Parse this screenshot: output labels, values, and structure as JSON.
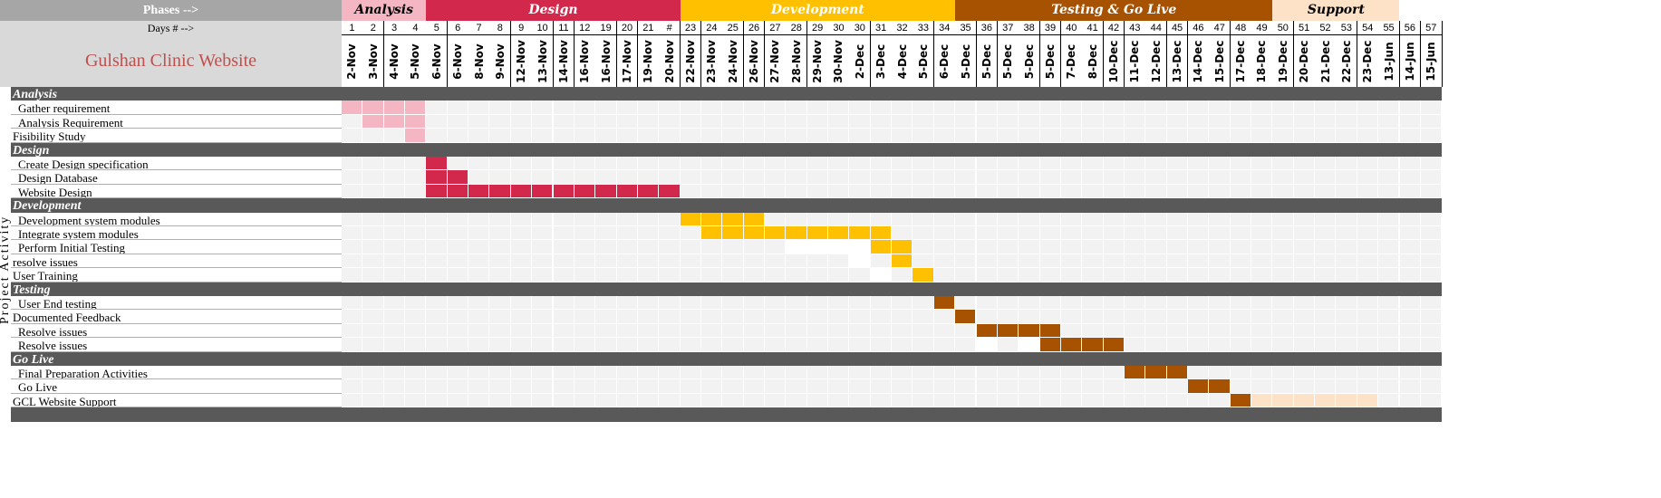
{
  "header": {
    "phases_label": "Phases -->",
    "days_label": "Days # -->",
    "project_title": "Gulshan Clinic Website",
    "side_label": "Project Activity"
  },
  "phase_headers": [
    {
      "label": "Analysis",
      "start": 0,
      "end": 3,
      "bg": "#f4b6c2",
      "color": "#000000"
    },
    {
      "label": "Design",
      "start": 4,
      "end": 15,
      "bg": "#d1284b",
      "color": "#ffffff"
    },
    {
      "label": "Development",
      "start": 16,
      "end": 28,
      "bg": "#ffc000",
      "color": "#ffffff"
    },
    {
      "label": "Testing & Go Live",
      "start": 29,
      "end": 43,
      "bg": "#a65200",
      "color": "#ffffff"
    },
    {
      "label": "Support",
      "start": 44,
      "end": 49,
      "bg": "#fde2c8",
      "color": "#000000"
    }
  ],
  "days": [
    "1",
    "2",
    "3",
    "4",
    "5",
    "6",
    "7",
    "8",
    "9",
    "10",
    "11",
    "12",
    "19",
    "20",
    "21",
    "#",
    "23",
    "24",
    "25",
    "26",
    "27",
    "28",
    "29",
    "30",
    "30",
    "31",
    "32",
    "33",
    "34",
    "35",
    "36",
    "37",
    "38",
    "39",
    "40",
    "41",
    "42",
    "43",
    "44",
    "45",
    "46",
    "47",
    "48",
    "49",
    "50",
    "51",
    "52",
    "53",
    "54",
    "55",
    "56",
    "57"
  ],
  "dates": [
    "2-Nov",
    "3-Nov",
    "4-Nov",
    "5-Nov",
    "6-Nov",
    "6-Nov",
    "8-Nov",
    "9-Nov",
    "12-Nov",
    "13-Nov",
    "14-Nov",
    "16-Nov",
    "16-Nov",
    "17-Nov",
    "19-Nov",
    "20-Nov",
    "22-Nov",
    "23-Nov",
    "24-Nov",
    "26-Nov",
    "27-Nov",
    "28-Nov",
    "29-Nov",
    "30-Nov",
    "2-Dec",
    "3-Dec",
    "4-Dec",
    "5-Dec",
    "6-Dec",
    "5-Dec",
    "5-Dec",
    "5-Dec",
    "5-Dec",
    "5-Dec",
    "7-Dec",
    "8-Dec",
    "10-Dec",
    "11-Dec",
    "12-Dec",
    "13-Dec",
    "14-Dec",
    "15-Dec",
    "17-Dec",
    "18-Dec",
    "19-Dec",
    "20-Dec",
    "21-Dec",
    "22-Dec",
    "23-Dec",
    "13-Jun",
    "14-Jun",
    "15-Jun"
  ],
  "colors": {
    "analysis": "#f4b6c2",
    "design": "#d1284b",
    "development": "#ffc000",
    "testing": "#a65200",
    "support": "#fde2c8",
    "white": "#ffffff",
    "band": "#595959"
  },
  "rows": [
    {
      "type": "phase",
      "label": "Analysis"
    },
    {
      "type": "task",
      "label": "Gather requirement",
      "indent": true,
      "bars": [
        {
          "start": 0,
          "end": 3,
          "color": "analysis"
        }
      ]
    },
    {
      "type": "task",
      "label": "Analysis Requirement",
      "indent": true,
      "bars": [
        {
          "start": 1,
          "end": 3,
          "color": "analysis"
        }
      ]
    },
    {
      "type": "task",
      "label": "Fisibility Study",
      "indent": false,
      "bars": [
        {
          "start": 3,
          "end": 3,
          "color": "analysis"
        }
      ]
    },
    {
      "type": "phase",
      "label": "Design"
    },
    {
      "type": "task",
      "label": "Create Design specification",
      "indent": true,
      "bars": [
        {
          "start": 4,
          "end": 4,
          "color": "design"
        }
      ]
    },
    {
      "type": "task",
      "label": "Design Database",
      "indent": true,
      "bars": [
        {
          "start": 4,
          "end": 5,
          "color": "design"
        }
      ]
    },
    {
      "type": "task",
      "label": "Website Design",
      "indent": true,
      "bars": [
        {
          "start": 4,
          "end": 15,
          "color": "design"
        }
      ]
    },
    {
      "type": "phase",
      "label": "Development"
    },
    {
      "type": "task",
      "label": "Development system modules",
      "indent": true,
      "bars": [
        {
          "start": 16,
          "end": 19,
          "color": "development"
        }
      ]
    },
    {
      "type": "task",
      "label": "Integrate system modules",
      "indent": true,
      "bars": [
        {
          "start": 17,
          "end": 25,
          "color": "development"
        }
      ]
    },
    {
      "type": "task",
      "label": "Perform Initial Testing",
      "indent": true,
      "bars": [
        {
          "start": 21,
          "end": 24,
          "color": "white"
        },
        {
          "start": 25,
          "end": 26,
          "color": "development"
        }
      ]
    },
    {
      "type": "task",
      "label": "resolve issues",
      "indent": false,
      "bars": [
        {
          "start": 24,
          "end": 24,
          "color": "white"
        },
        {
          "start": 26,
          "end": 26,
          "color": "development"
        }
      ]
    },
    {
      "type": "task",
      "label": "User Training",
      "indent": false,
      "bars": [
        {
          "start": 25,
          "end": 25,
          "color": "white"
        },
        {
          "start": 27,
          "end": 27,
          "color": "development"
        }
      ]
    },
    {
      "type": "phase",
      "label": "Testing"
    },
    {
      "type": "task",
      "label": "User End testing",
      "indent": true,
      "bars": [
        {
          "start": 28,
          "end": 28,
          "color": "testing"
        }
      ]
    },
    {
      "type": "task",
      "label": "Documented Feedback",
      "indent": false,
      "bars": [
        {
          "start": 29,
          "end": 29,
          "color": "testing"
        }
      ]
    },
    {
      "type": "task",
      "label": "Resolve issues",
      "indent": true,
      "bars": [
        {
          "start": 30,
          "end": 33,
          "color": "testing"
        }
      ]
    },
    {
      "type": "task",
      "label": "Resolve issues",
      "indent": true,
      "bars": [
        {
          "start": 30,
          "end": 30,
          "color": "white"
        },
        {
          "start": 32,
          "end": 32,
          "color": "white"
        },
        {
          "start": 33,
          "end": 36,
          "color": "testing"
        }
      ]
    },
    {
      "type": "phase",
      "label": "Go Live"
    },
    {
      "type": "task",
      "label": "Final Preparation Activities",
      "indent": true,
      "bars": [
        {
          "start": 37,
          "end": 39,
          "color": "testing"
        }
      ]
    },
    {
      "type": "task",
      "label": "Go Live",
      "indent": true,
      "bars": [
        {
          "start": 40,
          "end": 41,
          "color": "testing"
        }
      ]
    },
    {
      "type": "task",
      "label": "GCL Website Support",
      "indent": false,
      "bars": [
        {
          "start": 42,
          "end": 42,
          "color": "testing"
        },
        {
          "start": 43,
          "end": 48,
          "color": "support"
        }
      ]
    },
    {
      "type": "phase",
      "label": ""
    }
  ]
}
